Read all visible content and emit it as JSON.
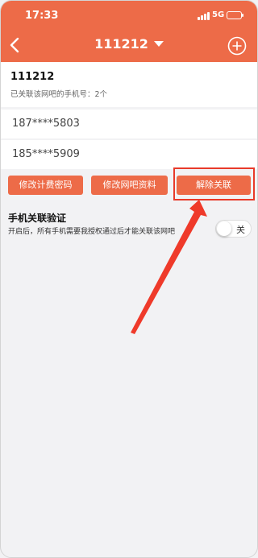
{
  "status_bar": {
    "time": "17:33",
    "network": "5G"
  },
  "nav": {
    "title": "111212"
  },
  "cafe": {
    "name": "111212",
    "bound_text": "已关联该网吧的手机号：2个"
  },
  "phones": [
    "187****5803",
    "185****5909"
  ],
  "buttons": {
    "change_billing_password": "修改计费密码",
    "edit_cafe_info": "修改网吧资料",
    "unbind": "解除关联"
  },
  "verification": {
    "title": "手机关联验证",
    "description": "开启后，所有手机需要我授权通过后才能关联该网吧",
    "toggle_label": "关",
    "enabled": false
  },
  "colors": {
    "accent": "#ed6b48",
    "highlight": "#e83a2a"
  },
  "icons": {
    "back": "chevron-left-icon",
    "dropdown": "caret-down-icon",
    "add": "plus-circle-icon"
  }
}
